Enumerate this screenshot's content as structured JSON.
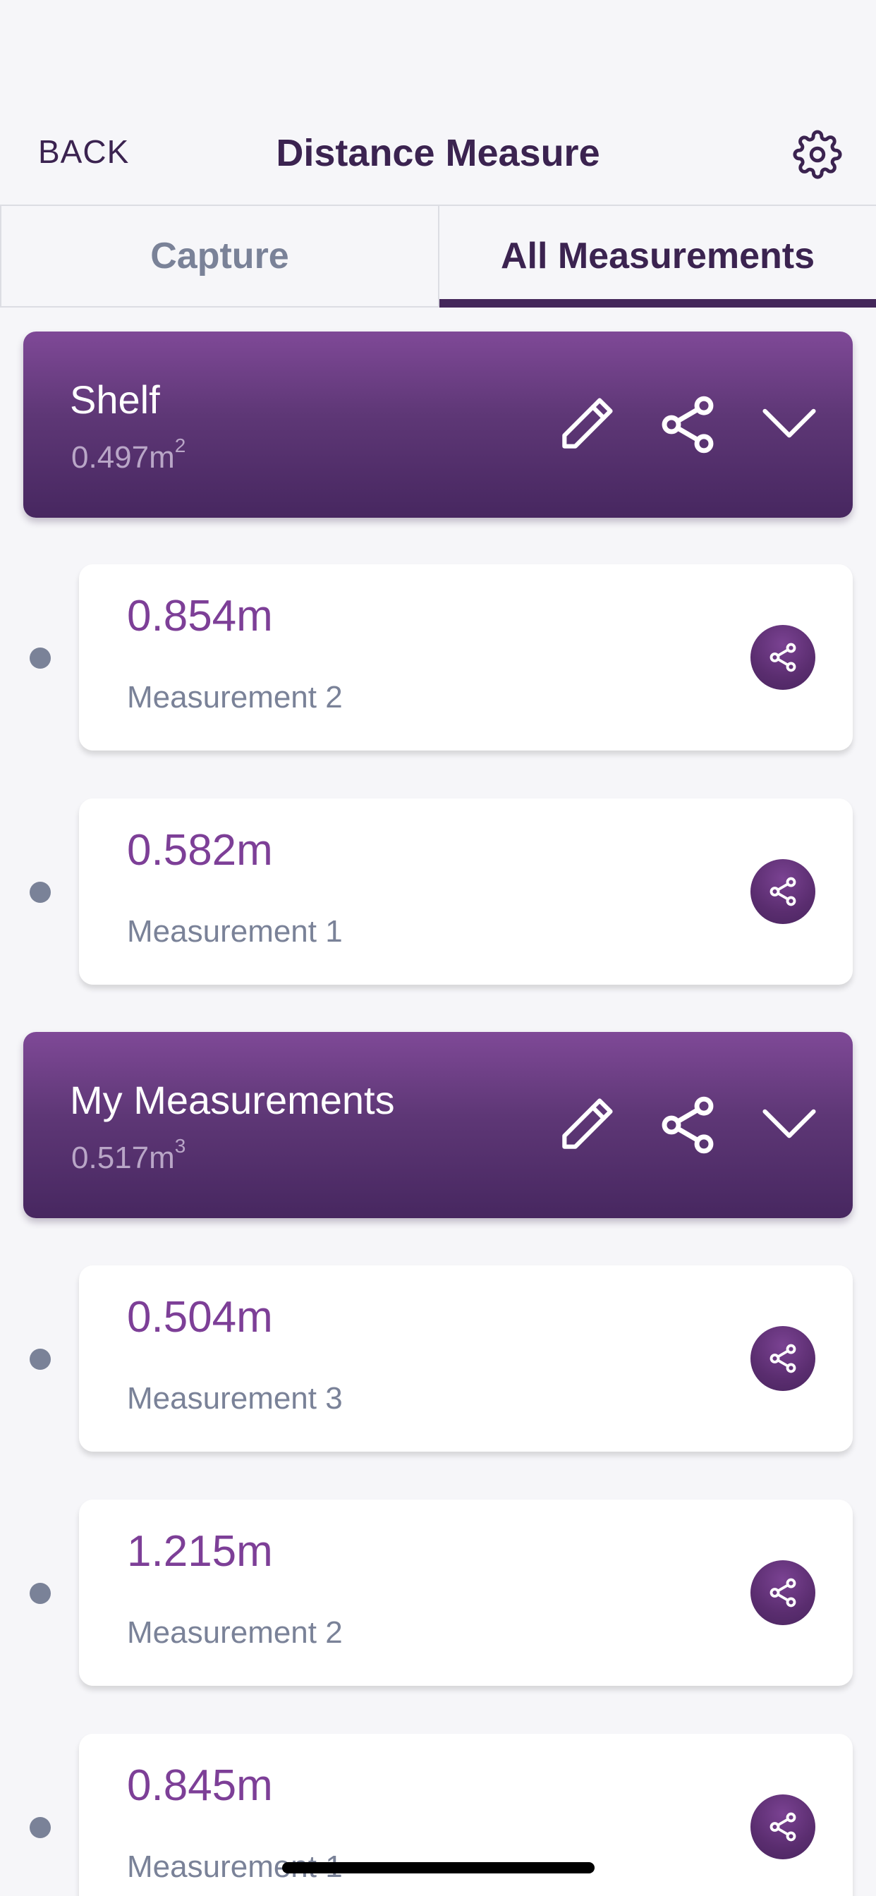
{
  "header": {
    "back_label": "BACK",
    "title": "Distance Measure",
    "settings_icon": "gear-icon"
  },
  "tabs": [
    {
      "label": "Capture",
      "active": false
    },
    {
      "label": "All Measurements",
      "active": true
    }
  ],
  "groups": [
    {
      "name": "Shelf",
      "value": "0.497m",
      "unit_power": "2",
      "measurements": [
        {
          "value": "0.854m",
          "label": "Measurement 2"
        },
        {
          "value": "0.582m",
          "label": "Measurement 1"
        }
      ]
    },
    {
      "name": "My Measurements",
      "value": "0.517m",
      "unit_power": "3",
      "measurements": [
        {
          "value": "0.504m",
          "label": "Measurement 3"
        },
        {
          "value": "1.215m",
          "label": "Measurement 2"
        },
        {
          "value": "0.845m",
          "label": "Measurement 1"
        }
      ]
    }
  ],
  "colors": {
    "accent": "#44275a",
    "value_purple": "#7d3f97",
    "muted": "#7a8298",
    "background": "#f6f6f9"
  }
}
